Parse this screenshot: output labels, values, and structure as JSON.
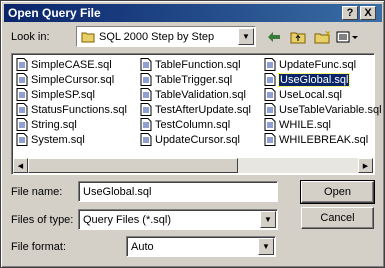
{
  "window": {
    "title": "Open Query File",
    "help_glyph": "?",
    "close_glyph": "X"
  },
  "look_in": {
    "label": "Look in:",
    "value": "SQL 2000 Step by Step",
    "folder_icon": "folder-icon"
  },
  "toolbar": {
    "icons": [
      "back-arrow-icon",
      "up-folder-icon",
      "new-folder-icon",
      "view-menu-icon"
    ]
  },
  "files": {
    "columns": [
      [
        "SimpleCASE.sql",
        "SimpleCursor.sql",
        "SimpleSP.sql",
        "StatusFunctions.sql",
        "String.sql",
        "System.sql"
      ],
      [
        "TableFunction.sql",
        "TableTrigger.sql",
        "TableValidation.sql",
        "TestAfterUpdate.sql",
        "TestColumn.sql",
        "UpdateCursor.sql"
      ],
      [
        "UpdateFunc.sql",
        "UseGlobal.sql",
        "UseLocal.sql",
        "UseTableVariable.sql",
        "WHILE.sql",
        "WHILEBREAK.sql"
      ]
    ],
    "selected": "UseGlobal.sql"
  },
  "file_name": {
    "label": "File name:",
    "value": "UseGlobal.sql"
  },
  "files_of_type": {
    "label": "Files of type:",
    "value": "Query Files (*.sql)"
  },
  "file_format": {
    "label": "File format:",
    "value": "Auto"
  },
  "buttons": {
    "open": "Open",
    "cancel": "Cancel"
  }
}
